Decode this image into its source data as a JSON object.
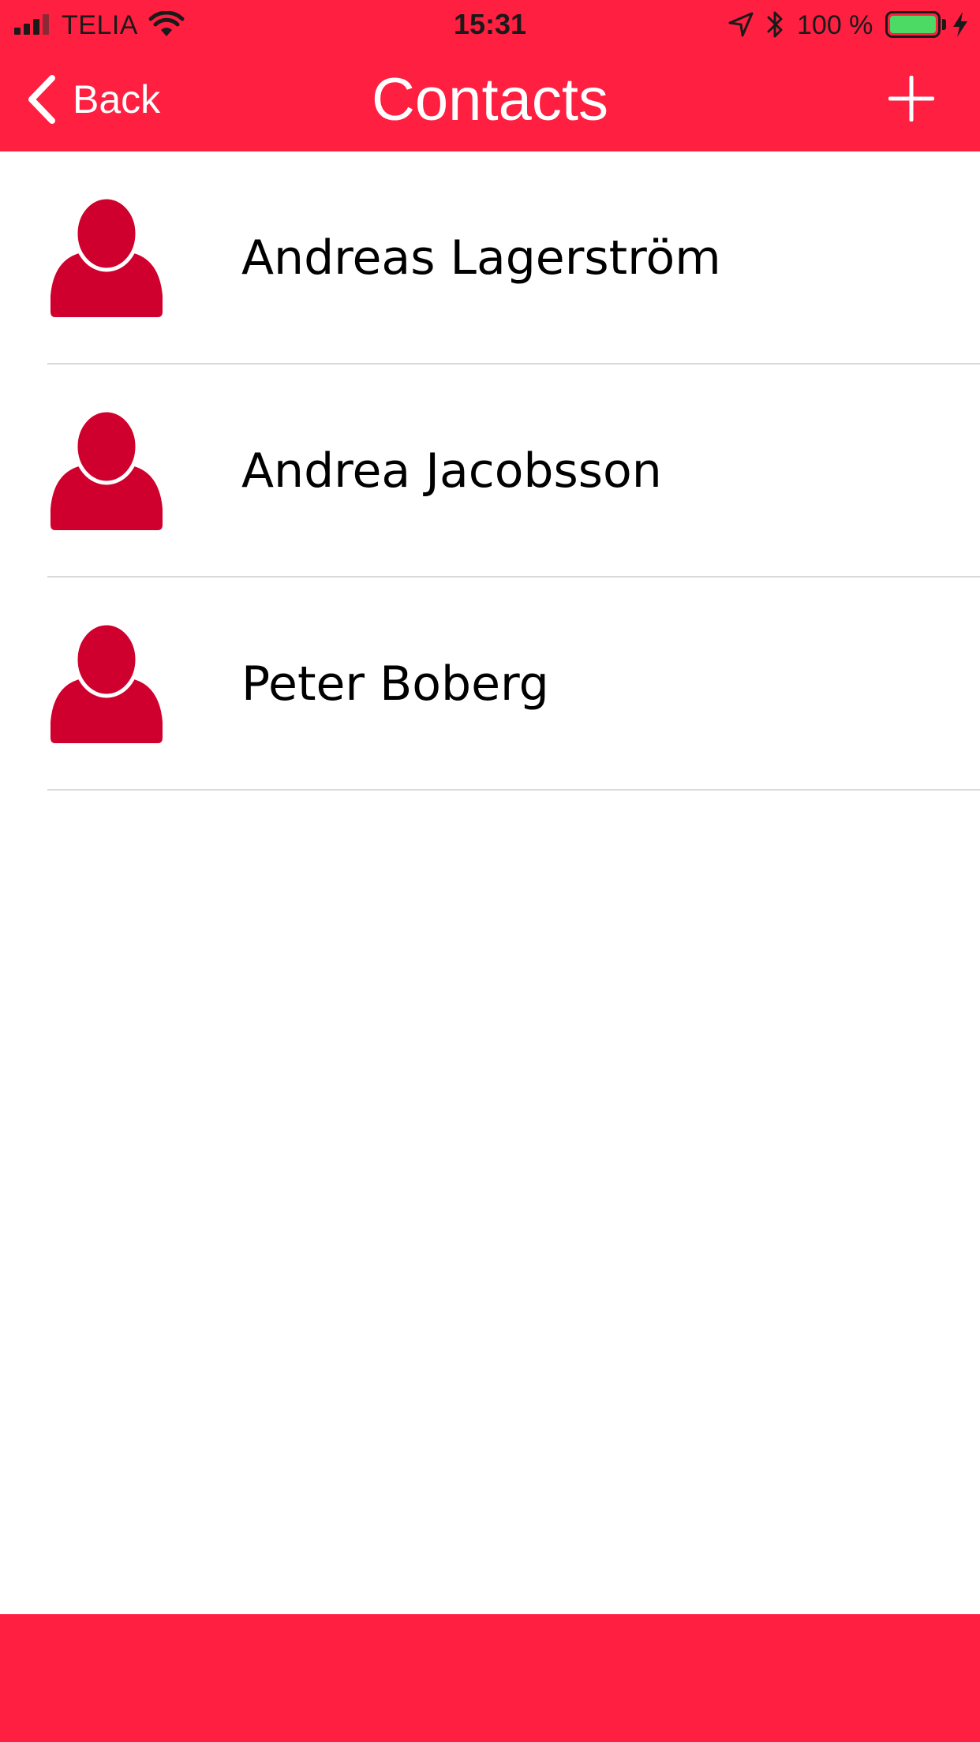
{
  "status_bar": {
    "carrier": "TELIA",
    "time": "15:31",
    "battery_percent": "100 %",
    "battery_level": 1.0,
    "battery_color": "#4cd964"
  },
  "nav": {
    "back_label": "Back",
    "title": "Contacts",
    "add_icon": "plus-icon"
  },
  "contacts": [
    {
      "name": "Andreas Lagerström",
      "icon": "person-icon"
    },
    {
      "name": "Andrea Jacobsson",
      "icon": "person-icon"
    },
    {
      "name": "Peter Boberg",
      "icon": "person-icon"
    }
  ],
  "colors": {
    "accent": "#ff1f40",
    "avatar": "#d0002e",
    "divider": "#d9d9d9"
  }
}
